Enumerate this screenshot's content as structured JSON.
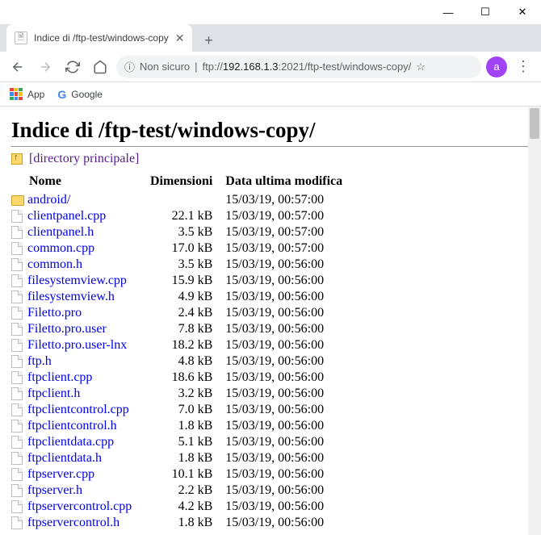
{
  "window": {
    "min": "—",
    "max": "☐",
    "close": "✕"
  },
  "tab": {
    "title": "Indice di /ftp-test/windows-copy",
    "close": "✕",
    "new": "+"
  },
  "toolbar": {
    "secure_label": "Non sicuro",
    "url_prefix": "ftp://",
    "url_host": "192.168.1.3",
    "url_port": ":2021",
    "url_path": "/ftp-test/windows-copy/",
    "avatar_letter": "a"
  },
  "bookmarks": {
    "apps": "App",
    "google": "Google"
  },
  "page": {
    "heading": "Indice di /ftp-test/windows-copy/",
    "parent_label": "[directory principale]",
    "col_name": "Nome",
    "col_size": "Dimensioni",
    "col_date": "Data ultima modifica"
  },
  "rows": [
    {
      "icon": "dir",
      "name": "android/",
      "size": "",
      "date": "15/03/19, 00:57:00"
    },
    {
      "icon": "file",
      "name": "clientpanel.cpp",
      "size": "22.1 kB",
      "date": "15/03/19, 00:57:00"
    },
    {
      "icon": "file",
      "name": "clientpanel.h",
      "size": "3.5 kB",
      "date": "15/03/19, 00:57:00"
    },
    {
      "icon": "file",
      "name": "common.cpp",
      "size": "17.0 kB",
      "date": "15/03/19, 00:57:00"
    },
    {
      "icon": "file",
      "name": "common.h",
      "size": "3.5 kB",
      "date": "15/03/19, 00:56:00"
    },
    {
      "icon": "file",
      "name": "filesystemview.cpp",
      "size": "15.9 kB",
      "date": "15/03/19, 00:56:00"
    },
    {
      "icon": "file",
      "name": "filesystemview.h",
      "size": "4.9 kB",
      "date": "15/03/19, 00:56:00"
    },
    {
      "icon": "file",
      "name": "Filetto.pro",
      "size": "2.4 kB",
      "date": "15/03/19, 00:56:00"
    },
    {
      "icon": "file",
      "name": "Filetto.pro.user",
      "size": "7.8 kB",
      "date": "15/03/19, 00:56:00"
    },
    {
      "icon": "file",
      "name": "Filetto.pro.user-lnx",
      "size": "18.2 kB",
      "date": "15/03/19, 00:56:00"
    },
    {
      "icon": "file",
      "name": "ftp.h",
      "size": "4.8 kB",
      "date": "15/03/19, 00:56:00"
    },
    {
      "icon": "file",
      "name": "ftpclient.cpp",
      "size": "18.6 kB",
      "date": "15/03/19, 00:56:00"
    },
    {
      "icon": "file",
      "name": "ftpclient.h",
      "size": "3.2 kB",
      "date": "15/03/19, 00:56:00"
    },
    {
      "icon": "file",
      "name": "ftpclientcontrol.cpp",
      "size": "7.0 kB",
      "date": "15/03/19, 00:56:00"
    },
    {
      "icon": "file",
      "name": "ftpclientcontrol.h",
      "size": "1.8 kB",
      "date": "15/03/19, 00:56:00"
    },
    {
      "icon": "file",
      "name": "ftpclientdata.cpp",
      "size": "5.1 kB",
      "date": "15/03/19, 00:56:00"
    },
    {
      "icon": "file",
      "name": "ftpclientdata.h",
      "size": "1.8 kB",
      "date": "15/03/19, 00:56:00"
    },
    {
      "icon": "file",
      "name": "ftpserver.cpp",
      "size": "10.1 kB",
      "date": "15/03/19, 00:56:00"
    },
    {
      "icon": "file",
      "name": "ftpserver.h",
      "size": "2.2 kB",
      "date": "15/03/19, 00:56:00"
    },
    {
      "icon": "file",
      "name": "ftpservercontrol.cpp",
      "size": "4.2 kB",
      "date": "15/03/19, 00:56:00"
    },
    {
      "icon": "file",
      "name": "ftpservercontrol.h",
      "size": "1.8 kB",
      "date": "15/03/19, 00:56:00"
    }
  ]
}
